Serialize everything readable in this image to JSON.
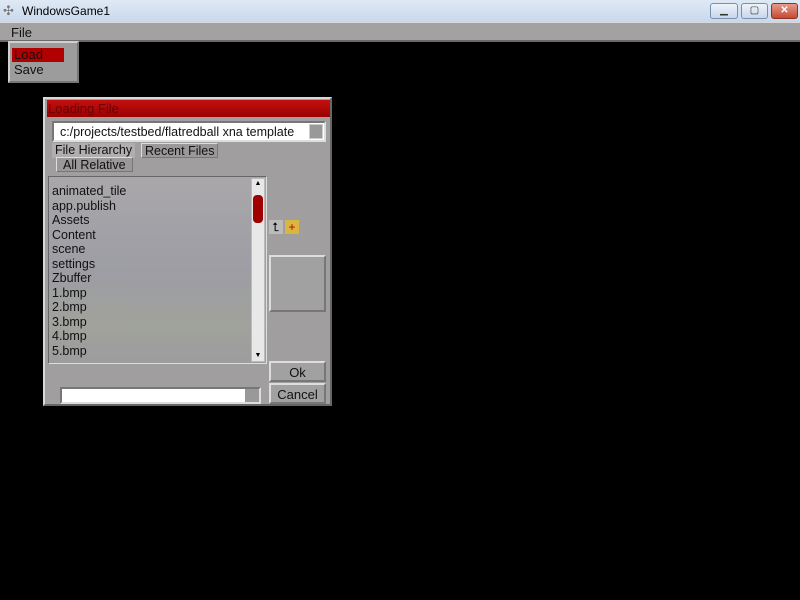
{
  "window": {
    "title": "WindowsGame1",
    "minimize": "▁",
    "maximize": "▢",
    "close": "✕"
  },
  "menu": {
    "file": "File",
    "items": [
      {
        "label": "Load",
        "selected": true
      },
      {
        "label": "Save",
        "selected": false
      }
    ]
  },
  "dialog": {
    "title": "Loading File",
    "path": "c:/projects/testbed/flatredball xna template",
    "tabs": {
      "hierarchy": "File Hierarchy",
      "recent": "Recent Files",
      "relative": "All Relative"
    },
    "files": [
      "animated_tile",
      "app.publish",
      "Assets",
      "Content",
      "scene",
      "settings",
      "Zbuffer",
      "1.bmp",
      "2.bmp",
      "3.bmp",
      "4.bmp",
      "5.bmp"
    ],
    "scroll_position_percent": 0,
    "ok": "Ok",
    "cancel": "Cancel",
    "filename": "",
    "accent": "#b00000"
  }
}
